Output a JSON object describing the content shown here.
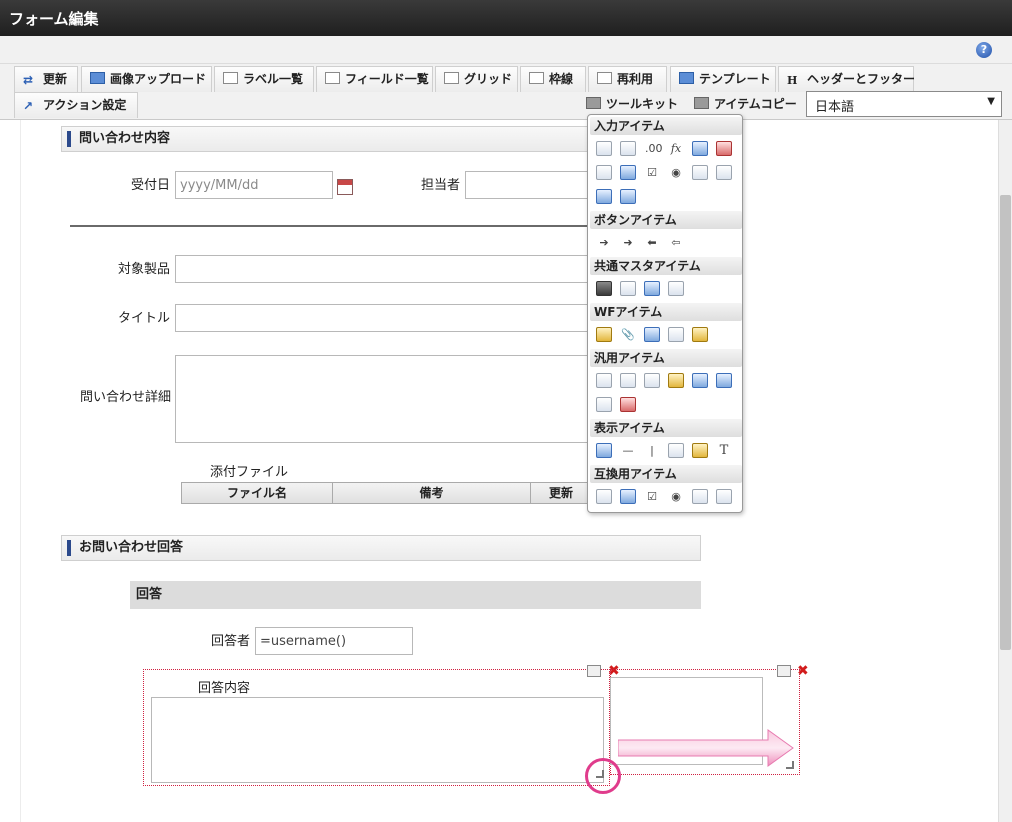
{
  "window": {
    "title": "フォーム編集"
  },
  "toolbar": {
    "row1": [
      {
        "label": "更新",
        "icon": "refresh-icon"
      },
      {
        "label": "画像アップロード",
        "icon": "image-upload-icon"
      },
      {
        "label": "ラベル一覧",
        "icon": "label-list-icon"
      },
      {
        "label": "フィールド一覧",
        "icon": "field-list-icon"
      },
      {
        "label": "グリッド",
        "icon": "grid-icon"
      },
      {
        "label": "枠線",
        "icon": "border-icon"
      },
      {
        "label": "再利用",
        "icon": "reuse-icon"
      },
      {
        "label": "テンプレート",
        "icon": "template-icon"
      },
      {
        "label": "ヘッダーとフッター",
        "icon": "header-footer-icon"
      }
    ],
    "row2": [
      {
        "label": "アクション設定",
        "icon": "action-icon"
      },
      {
        "label": "ツールキット",
        "icon": "toolkit-icon"
      },
      {
        "label": "アイテムコピー",
        "icon": "item-copy-icon"
      }
    ],
    "language": "日本語"
  },
  "form": {
    "section1": "問い合わせ内容",
    "date_label": "受付日",
    "date_placeholder": "yyyy/MM/dd",
    "assignee_label": "担当者",
    "product_label": "対象製品",
    "title_label": "タイトル",
    "detail_label": "問い合わせ詳細",
    "attachments_label": "添付ファイル",
    "attach_cols": [
      "ファイル名",
      "備考",
      "更新"
    ],
    "section2": "お問い合わせ回答",
    "subsection": "回答",
    "responder_label": "回答者",
    "responder_value": "=username()",
    "answer_label": "回答内容"
  },
  "palette": {
    "categories": [
      "入力アイテム",
      "ボタンアイテム",
      "共通マスタアイテム",
      "WFアイテム",
      "汎用アイテム",
      "表示アイテム",
      "互換用アイテム"
    ],
    "fx_glyph": "fx",
    "text_glyph": "T"
  },
  "colors": {
    "accent": "#2c4a8c",
    "highlight": "#e03c8c",
    "delete": "#d21c1c"
  }
}
